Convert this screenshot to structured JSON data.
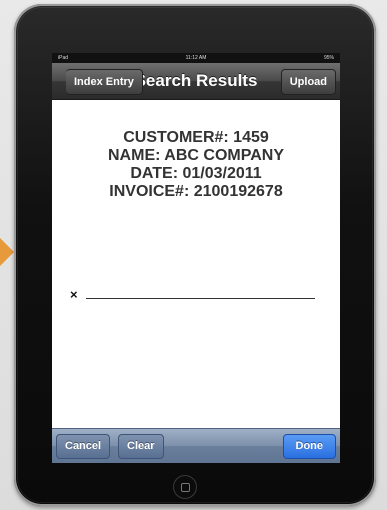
{
  "status_bar": {
    "carrier": "iPad",
    "time": "11:12 AM",
    "battery": "95%"
  },
  "nav": {
    "back_label": "Index Entry",
    "title": "Search Results",
    "upload_label": "Upload"
  },
  "info": {
    "customer": "CUSTOMER#: 1459",
    "name": "NAME: ABC COMPANY",
    "date": "DATE: 01/03/2011",
    "invoice": "INVOICE#: 2100192678"
  },
  "signature": {
    "mark": "×"
  },
  "toolbar": {
    "cancel_label": "Cancel",
    "clear_label": "Clear",
    "done_label": "Done"
  },
  "colors": {
    "accent_orange": "#e79a3b",
    "done_blue": "#2a6fe0",
    "toolbar_blue": "#7d90aa"
  },
  "icons": {
    "pointer": "orange-arrow-icon",
    "home": "home-button-icon"
  }
}
